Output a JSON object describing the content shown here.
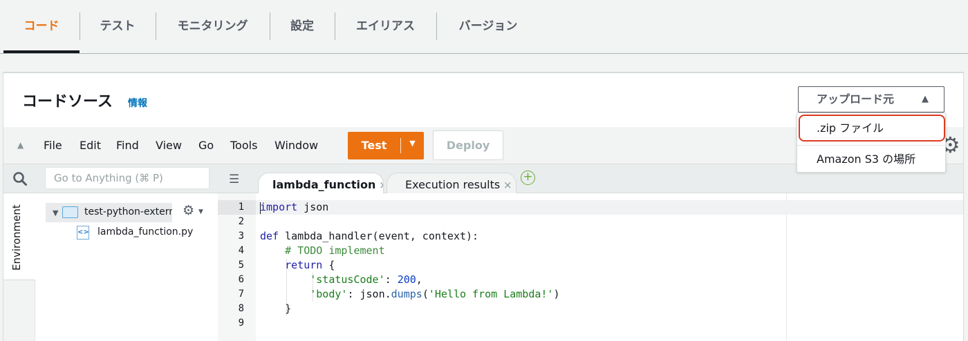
{
  "tabs": [
    {
      "label": "コード",
      "active": true
    },
    {
      "label": "テスト"
    },
    {
      "label": "モニタリング"
    },
    {
      "label": "設定"
    },
    {
      "label": "エイリアス"
    },
    {
      "label": "バージョン"
    }
  ],
  "panel": {
    "title": "コードソース",
    "info_link": "情報"
  },
  "upload": {
    "label": "アップロード元",
    "caret": "▲"
  },
  "dropdown": {
    "items": [
      ".zip ファイル",
      "Amazon S3 の場所"
    ]
  },
  "toolbar": {
    "menu": [
      "File",
      "Edit",
      "Find",
      "View",
      "Go",
      "Tools",
      "Window"
    ],
    "test_label": "Test",
    "deploy_label": "Deploy"
  },
  "search": {
    "placeholder": "Go to Anything (⌘ P)"
  },
  "environment": {
    "label": "Environment"
  },
  "tree": {
    "folder": "test-python-externa",
    "file": "lambda_function.py"
  },
  "editor": {
    "tabs": [
      {
        "label": "lambda_function",
        "active": true
      },
      {
        "label": "Execution results"
      }
    ],
    "line_numbers": [
      "1",
      "2",
      "3",
      "4",
      "5",
      "6",
      "7",
      "8",
      "9"
    ]
  },
  "colors": {
    "accent": "#ec7211",
    "link": "#0073bb",
    "highlight": "#dc3a1f"
  }
}
